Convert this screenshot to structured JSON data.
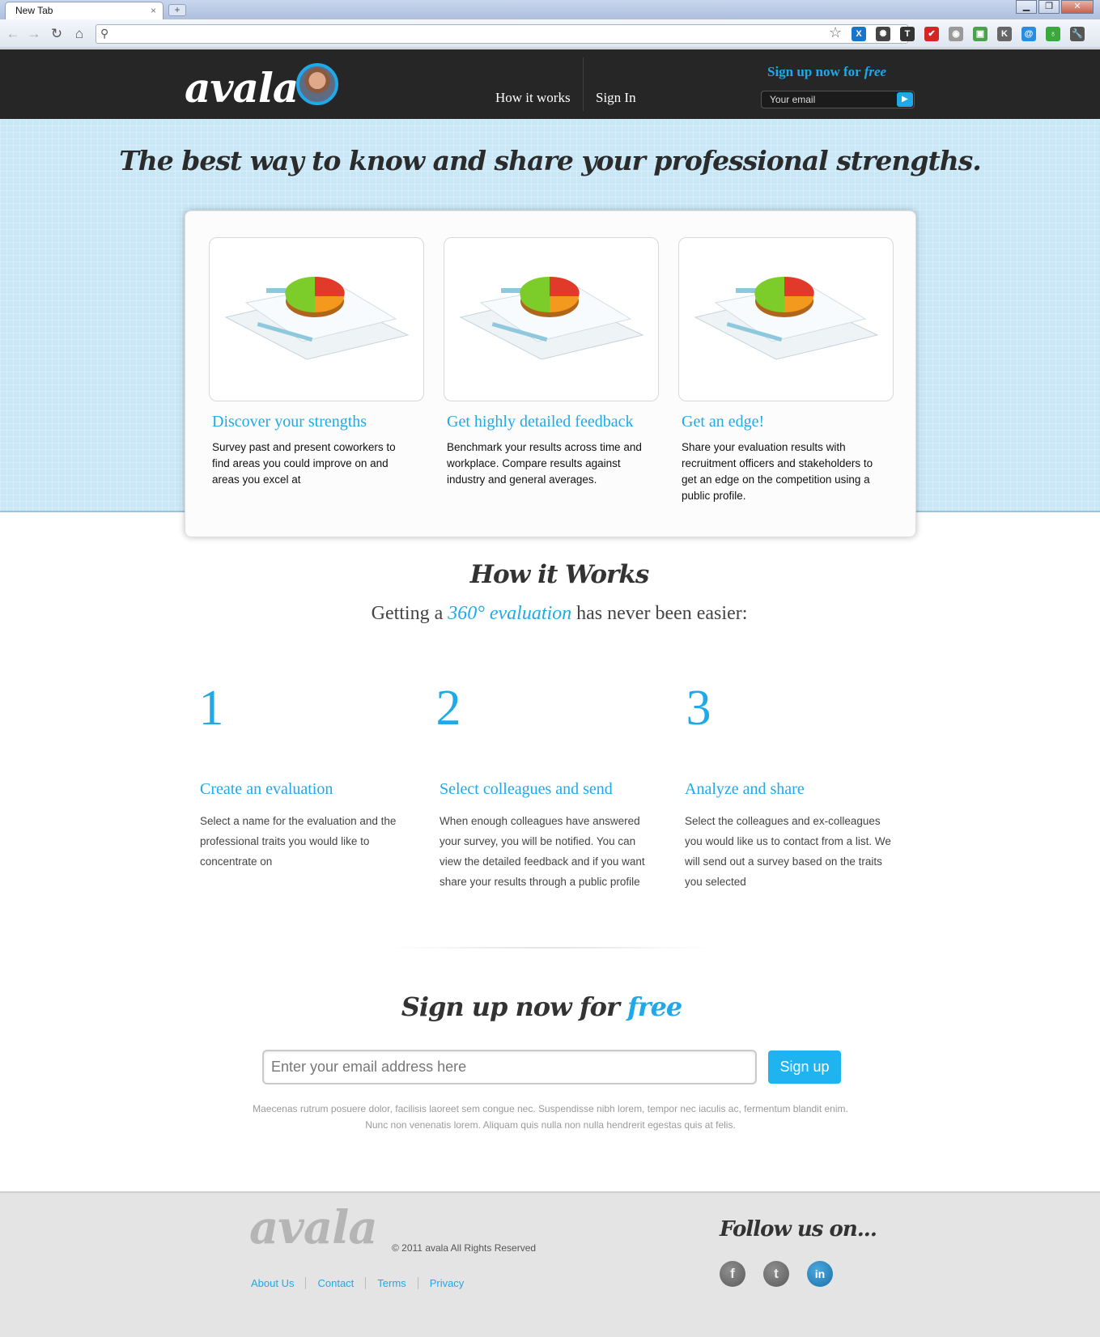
{
  "browser": {
    "tab_title": "New Tab",
    "tab_close": "×",
    "new_tab": "+",
    "window_buttons": [
      "▁",
      "❐",
      "✕"
    ],
    "nav_icons": [
      "back-arrow-icon",
      "forward-arrow-icon",
      "reload-icon",
      "home-icon"
    ],
    "extensions": [
      {
        "name": "ext-blue-x-icon",
        "glyph": "X",
        "color": "#1a74c9"
      },
      {
        "name": "ext-gear-icon",
        "glyph": "✺",
        "color": "#444444"
      },
      {
        "name": "ext-t-icon",
        "glyph": "T",
        "color": "#333333"
      },
      {
        "name": "ext-red-flag-icon",
        "glyph": "✔",
        "color": "#d32626"
      },
      {
        "name": "ext-grey-circle-icon",
        "glyph": "◉",
        "color": "#9a9a9a"
      },
      {
        "name": "ext-green-box-icon",
        "glyph": "▣",
        "color": "#4aa34a"
      },
      {
        "name": "ext-k-icon",
        "glyph": "K",
        "color": "#666666"
      },
      {
        "name": "ext-blue-a-icon",
        "glyph": "@",
        "color": "#2a8ee0"
      },
      {
        "name": "ext-green-apple-icon",
        "glyph": "♁",
        "color": "#3aa83a"
      },
      {
        "name": "wrench-icon",
        "glyph": "🔧",
        "color": "#555555"
      }
    ]
  },
  "header": {
    "logo": "avala",
    "nav": [
      {
        "label": "How it works"
      },
      {
        "label": "Sign In"
      }
    ],
    "signup_prefix": "Sign up now for ",
    "signup_free": "free",
    "email_placeholder": "Your email"
  },
  "hero": {
    "title": "The best way to know and share your professional strengths."
  },
  "features": [
    {
      "title": "Discover your strengths",
      "text": "Survey past and present coworkers to find areas you could improve on and areas you excel at"
    },
    {
      "title": "Get highly detailed feedback",
      "text": "Benchmark your results across time and workplace. Compare results against industry and general averages."
    },
    {
      "title": "Get an edge!",
      "text": "Share your evaluation results with recruitment officers and stakeholders to get an edge on the competition using a public profile."
    }
  ],
  "how_it_works": {
    "title": "How it Works",
    "sub_before": "Getting a ",
    "sub_highlight": "360° evaluation",
    "sub_after": " has never been easier:",
    "steps": [
      {
        "number": "1",
        "title": "Create an evaluation",
        "text": "Select a name for the evaluation and the professional traits you would like to concentrate on"
      },
      {
        "number": "2",
        "title": "Select colleagues and send",
        "text": "When enough colleagues have answered your survey, you will be notified. You can view the detailed feedback and if you want share your results through a public profile"
      },
      {
        "number": "3",
        "title": "Analyze and share",
        "text": "Select the colleagues and ex-colleagues you would like us to contact from a list. We will send out a survey based on the traits you selected"
      }
    ]
  },
  "signup": {
    "title_prefix": "Sign up now for ",
    "title_free": "free",
    "placeholder": "Enter your email address here",
    "button": "Sign up",
    "fineprint": "Maecenas rutrum posuere dolor, facilisis laoreet sem congue nec. Suspendisse nibh lorem, tempor nec iaculis ac, fermentum blandit enim. Nunc non venenatis lorem. Aliquam quis nulla non nulla hendrerit egestas quis at felis."
  },
  "footer": {
    "logo": "avala",
    "copyright": "© 2011 avala All Rights Reserved",
    "links": [
      "About Us",
      "Contact",
      "Terms",
      "Privacy"
    ],
    "follow": "Follow us on...",
    "social": [
      {
        "name": "facebook-icon",
        "glyph": "f"
      },
      {
        "name": "twitter-icon",
        "glyph": "t"
      },
      {
        "name": "linkedin-icon",
        "glyph": "in"
      }
    ]
  },
  "colors": {
    "accent": "#1fa9e8",
    "header_bg": "#262626",
    "hero_bg": "#c8e7f7",
    "footer_bg": "#e4e4e4"
  }
}
